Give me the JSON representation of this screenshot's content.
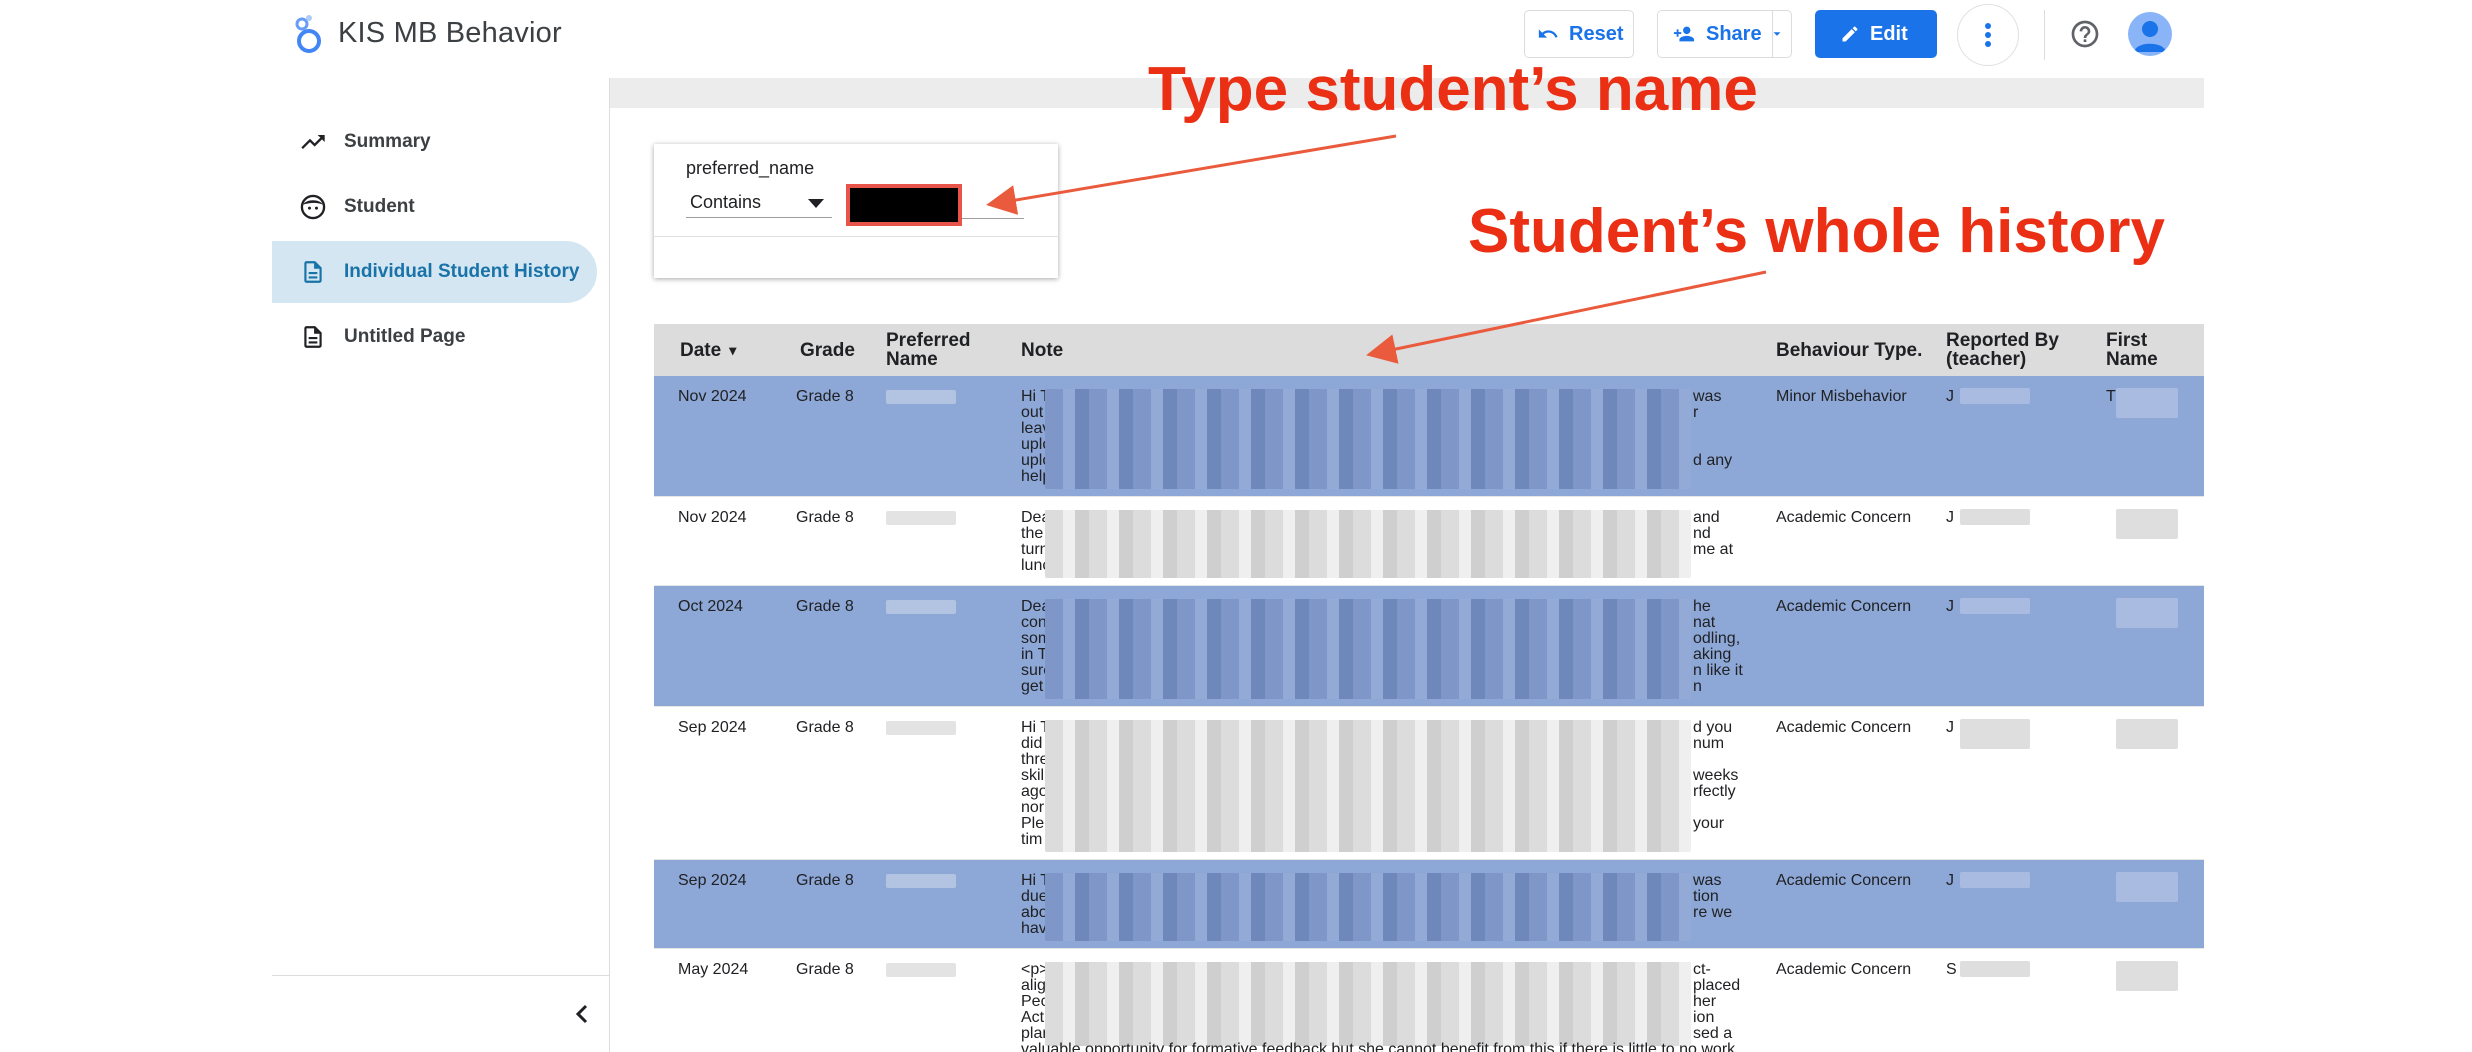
{
  "app": {
    "title": "KIS MB Behavior"
  },
  "toolbar": {
    "reset_label": "Reset",
    "share_label": "Share",
    "edit_label": "Edit"
  },
  "sidebar": {
    "items": [
      {
        "label": "Summary",
        "icon": "trending-up-icon",
        "active": false
      },
      {
        "label": "Student",
        "icon": "face-icon",
        "active": false
      },
      {
        "label": "Individual Student History",
        "icon": "document-icon",
        "active": true
      },
      {
        "label": "Untitled Page",
        "icon": "document-outline-icon",
        "active": false
      }
    ]
  },
  "filter": {
    "field_label": "preferred_name",
    "operator": "Contains",
    "value": ""
  },
  "table": {
    "headers": {
      "date": "Date",
      "grade": "Grade",
      "preferred_name": "Preferred Name",
      "note": "Note",
      "behaviour_type": "Behaviour Type.",
      "reported_by": "Reported By (teacher)",
      "first_name": "First Name"
    },
    "sort_indicator": "▾",
    "rows": [
      {
        "date": "Nov 2024",
        "grade": "Grade 8",
        "behaviour_type": "Minor Misbehavior",
        "note_left": [
          "Hi T",
          "out",
          "leav",
          "uplo",
          "uplo",
          "help"
        ],
        "note_right": [
          "was",
          "r",
          "",
          "",
          "d any",
          ""
        ],
        "reported_by": "J",
        "first_name": "T"
      },
      {
        "date": "Nov 2024",
        "grade": "Grade 8",
        "behaviour_type": "Academic Concern",
        "note_left": [
          "Dea",
          "the",
          "turn",
          "lunc"
        ],
        "note_right": [
          "and",
          "nd",
          "me at",
          ""
        ],
        "reported_by": "J",
        "first_name": ""
      },
      {
        "date": "Oct 2024",
        "grade": "Grade 8",
        "behaviour_type": "Academic Concern",
        "note_left": [
          "Dea",
          "con",
          "som",
          "in T",
          "sure",
          "get"
        ],
        "note_right": [
          "he",
          "nat",
          "odling,",
          "aking",
          "n like it",
          "n"
        ],
        "reported_by": "J",
        "first_name": ""
      },
      {
        "date": "Sep 2024",
        "grade": "Grade 8",
        "behaviour_type": "Academic Concern",
        "note_left": [
          "Hi T",
          "did",
          "thre",
          "skil",
          "ago",
          "nor",
          "Ple",
          "tim"
        ],
        "note_right": [
          "d you",
          "num",
          "",
          "weeks",
          "rfectly",
          "",
          "your",
          ""
        ],
        "reported_by": "J",
        "first_name": ""
      },
      {
        "date": "Sep 2024",
        "grade": "Grade 8",
        "behaviour_type": "Academic Concern",
        "note_left": [
          "Hi T",
          "due",
          "abo",
          "hav"
        ],
        "note_right": [
          "was",
          "tion",
          "re we",
          ""
        ],
        "reported_by": "J",
        "first_name": ""
      },
      {
        "date": "May 2024",
        "grade": "Grade 8",
        "behaviour_type": "Academic Concern",
        "note_left": [
          "<p>",
          "alig",
          "Pec",
          "Act",
          "plar"
        ],
        "note_right": [
          "ct-",
          "placed",
          "her",
          "ion",
          "sed a"
        ],
        "note_last": "valuable opportunity for formative feedback but she cannot benefit from this if there is little to no work",
        "reported_by": "S",
        "first_name": ""
      }
    ]
  },
  "annotations": {
    "top": "Type student’s name",
    "middle": "Student’s whole history"
  },
  "colors": {
    "accent": "#1a73e8",
    "alt_row": "#8da7d6",
    "annotation": "#ea2f14",
    "active_nav": "#d3e6f2"
  }
}
